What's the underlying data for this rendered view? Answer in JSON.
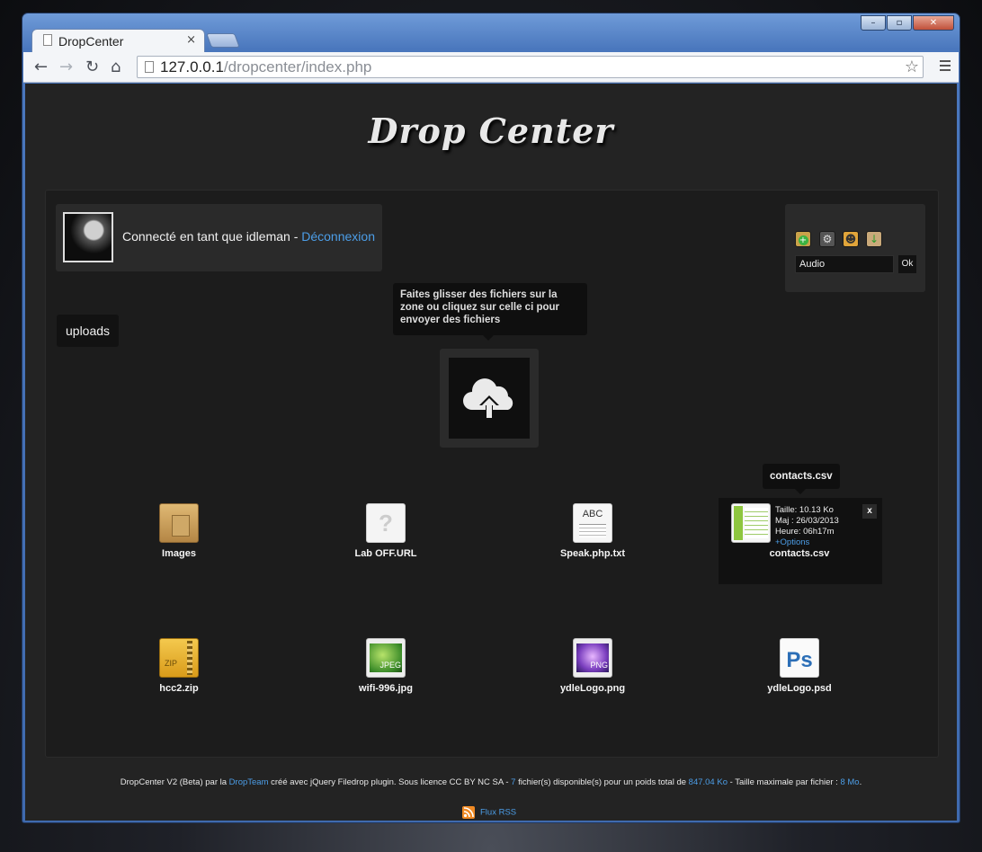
{
  "browser": {
    "tab_title": "DropCenter",
    "tab_close": "×",
    "url_host": "127.0.0.1",
    "url_path": "/dropcenter/index.php",
    "window_controls": [
      "minimize",
      "maximize",
      "close"
    ]
  },
  "header": {
    "logo": "Drop Center"
  },
  "user": {
    "label": "Connecté en tant que idleman -",
    "logout": "Déconnexion"
  },
  "tools": {
    "icons": [
      "add-folder-icon",
      "settings-icon",
      "user-icon",
      "download-icon"
    ],
    "input_value": "Audio",
    "ok_label": "Ok"
  },
  "folder": {
    "name": "uploads"
  },
  "dropzone": {
    "tooltip": "Faites glisser des fichiers sur la zone ou cliquez sur celle ci pour envoyer des fichiers"
  },
  "files": [
    {
      "name": "Images",
      "type": "folder"
    },
    {
      "name": "Lab OFF.URL",
      "type": "unknown",
      "badge": "?"
    },
    {
      "name": "Speak.php.txt",
      "type": "text",
      "badge": "ABC"
    },
    {
      "name": "contacts.csv",
      "type": "csv"
    },
    {
      "name": "hcc2.zip",
      "type": "zip",
      "badge": "ZIP"
    },
    {
      "name": "wifi-996.jpg",
      "type": "jpeg",
      "badge": "JPEG"
    },
    {
      "name": "ydleLogo.png",
      "type": "png",
      "badge": "PNG"
    },
    {
      "name": "ydleLogo.psd",
      "type": "psd",
      "badge": "Ps"
    }
  ],
  "hover": {
    "tooltip": "contacts.csv",
    "size": "Taille: 10.13 Ko",
    "modified": "Maj : 26/03/2013",
    "time": "Heure: 06h17m",
    "options": "+Options",
    "close": "x"
  },
  "footer": {
    "t1": "DropCenter V2 (Beta) par la",
    "team": "DropTeam",
    "t2": "créé avec jQuery Filedrop plugin. Sous licence CC BY NC SA -",
    "count": "7",
    "t3": "fichier(s) disponible(s) pour un poids total de",
    "total": "847.04 Ko",
    "t4": "- Taille maximale par fichier :",
    "max": "8 Mo",
    "t5": ".",
    "rss": "Flux RSS"
  }
}
